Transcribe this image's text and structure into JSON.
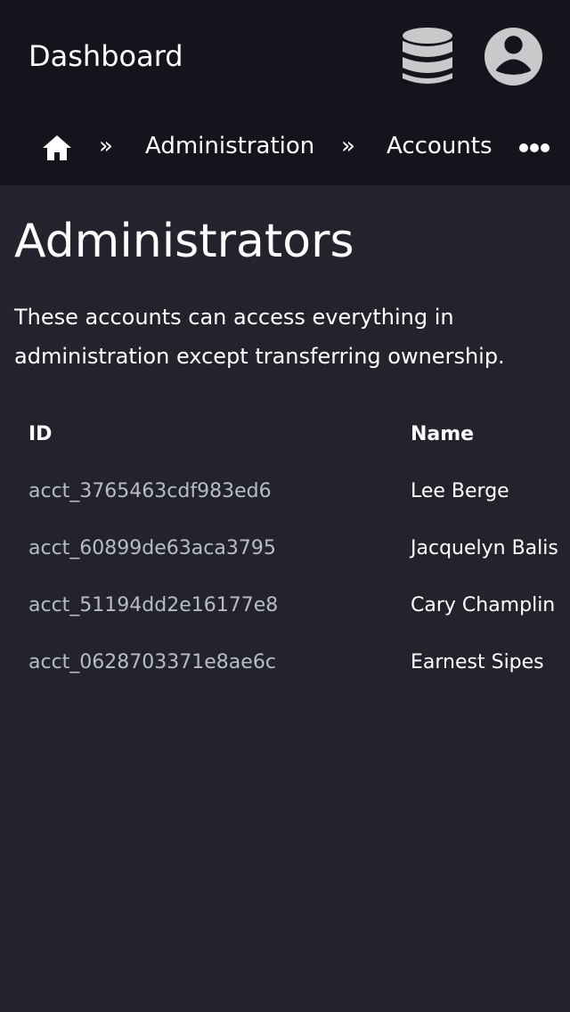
{
  "header": {
    "title": "Dashboard",
    "database_icon": "database-icon",
    "avatar_icon": "user-avatar-icon"
  },
  "breadcrumb": {
    "home_icon": "home-icon",
    "separator": "»",
    "items": [
      "Administration",
      "Accounts"
    ],
    "more_icon": "more-horizontal-icon"
  },
  "main": {
    "title": "Administrators",
    "description": "These accounts can access everything in administration except transferring ownership.",
    "table": {
      "columns": [
        "ID",
        "Name"
      ],
      "rows": [
        {
          "id": "acct_3765463cdf983ed6",
          "name": "Lee Berge"
        },
        {
          "id": "acct_60899de63aca3795",
          "name": "Jacquelyn Balis"
        },
        {
          "id": "acct_51194dd2e16177e8",
          "name": "Cary Champlin"
        },
        {
          "id": "acct_0628703371e8ae6c",
          "name": "Earnest Sipes"
        }
      ]
    }
  },
  "colors": {
    "header_bg": "#13141c",
    "page_bg": "#22232c",
    "id_text": "#b8bcc8",
    "icon_fill": "#c9c9cc"
  }
}
